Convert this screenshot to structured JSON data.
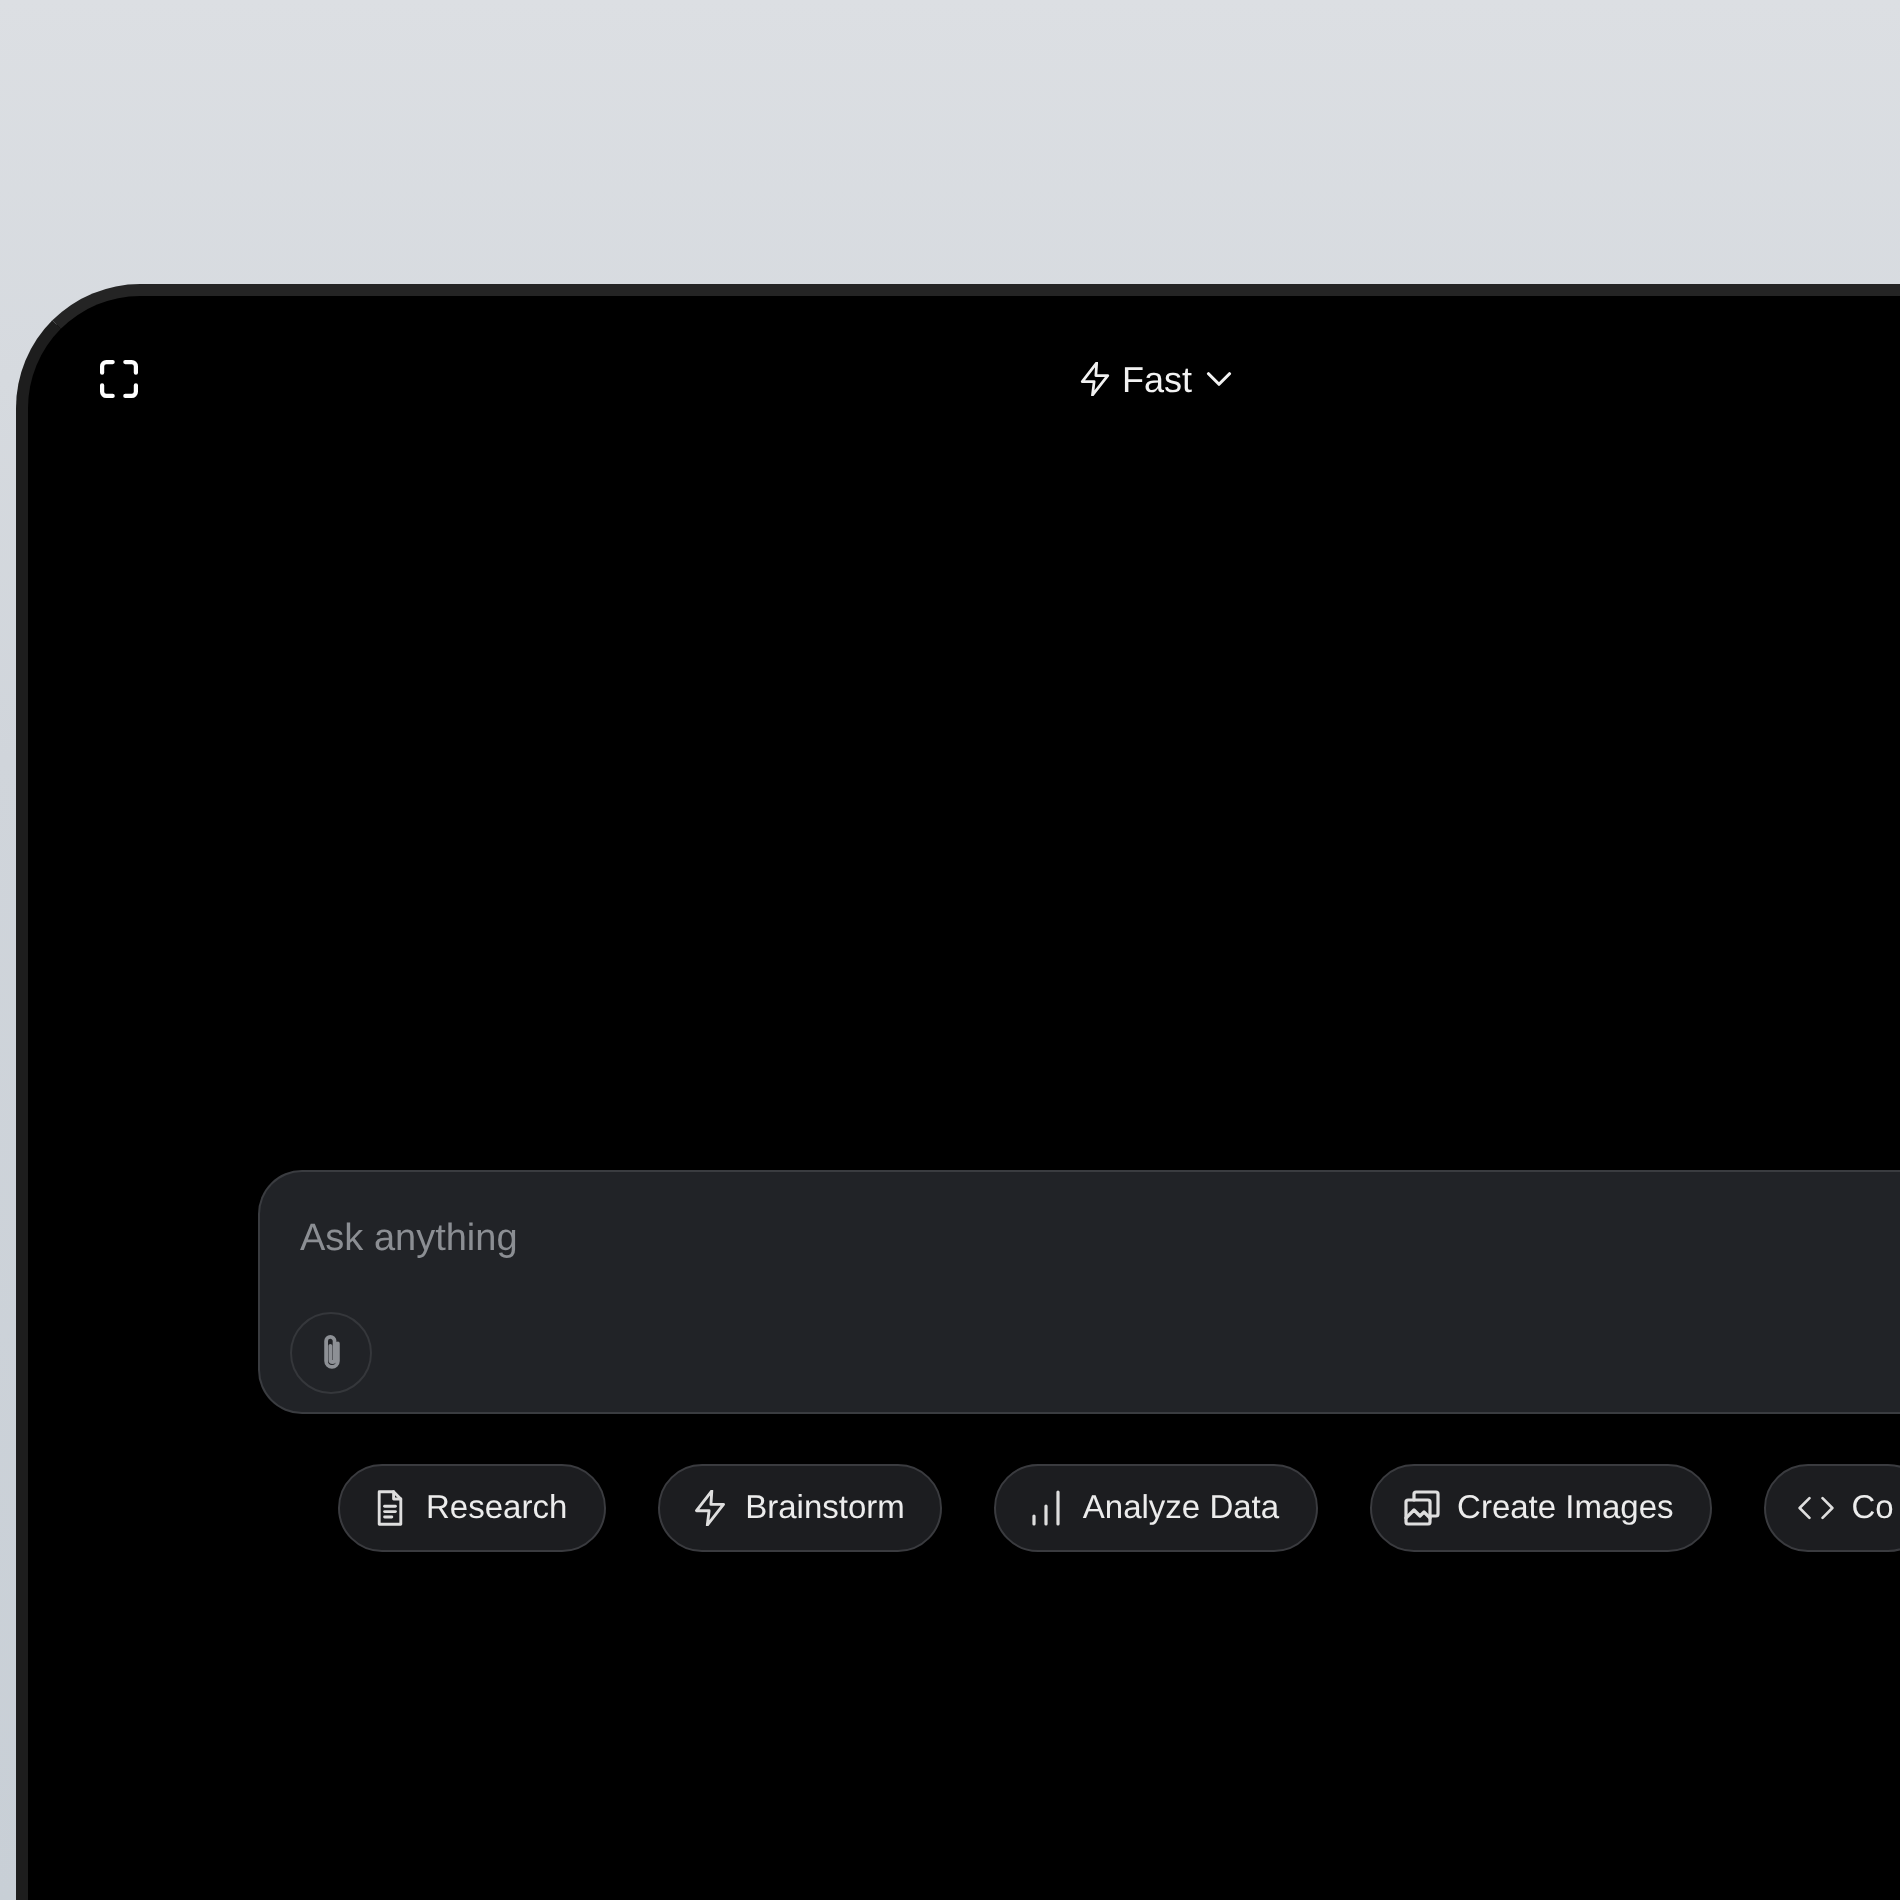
{
  "header": {
    "mode_selector": {
      "label": "Fast"
    }
  },
  "composer": {
    "placeholder": "Ask anything"
  },
  "suggestions": [
    {
      "label": "Research",
      "kind": "research"
    },
    {
      "label": "Brainstorm",
      "kind": "brainstorm"
    },
    {
      "label": "Analyze Data",
      "kind": "analyze"
    },
    {
      "label": "Create Images",
      "kind": "create"
    },
    {
      "label": "Co",
      "kind": "code"
    }
  ]
}
